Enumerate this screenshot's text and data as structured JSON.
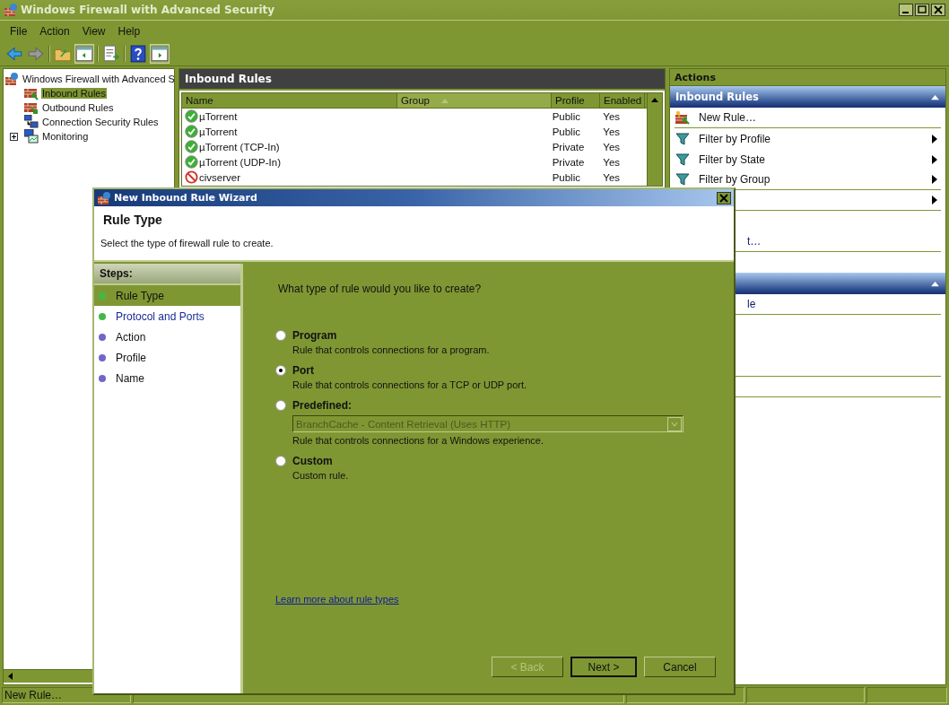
{
  "window": {
    "title": "Windows Firewall with Advanced Security"
  },
  "menu": [
    "File",
    "Action",
    "View",
    "Help"
  ],
  "tree": {
    "root": "Windows Firewall with Advanced S",
    "children": [
      {
        "label": "Inbound Rules",
        "selected": true,
        "kind": "inbound",
        "expandable": false
      },
      {
        "label": "Outbound Rules",
        "selected": false,
        "kind": "outbound",
        "expandable": false
      },
      {
        "label": "Connection Security Rules",
        "selected": false,
        "kind": "connection",
        "expandable": false
      },
      {
        "label": "Monitoring",
        "selected": false,
        "kind": "monitor",
        "expandable": true
      }
    ]
  },
  "center": {
    "title": "Inbound Rules",
    "columns": [
      {
        "label": "Name",
        "sorted": false
      },
      {
        "label": "Group",
        "sorted": true
      },
      {
        "label": "Profile",
        "sorted": false
      },
      {
        "label": "Enabled",
        "sorted": false
      }
    ],
    "rows": [
      {
        "name": "µTorrent",
        "profile": "Public",
        "enabled": "Yes",
        "kind": "allow"
      },
      {
        "name": "µTorrent",
        "profile": "Public",
        "enabled": "Yes",
        "kind": "allow"
      },
      {
        "name": "µTorrent (TCP-In)",
        "profile": "Private",
        "enabled": "Yes",
        "kind": "allow"
      },
      {
        "name": "µTorrent (UDP-In)",
        "profile": "Private",
        "enabled": "Yes",
        "kind": "allow"
      },
      {
        "name": "civserver",
        "profile": "Public",
        "enabled": "Yes",
        "kind": "block"
      }
    ]
  },
  "actions": {
    "title": "Actions",
    "sections": [
      {
        "title": "Inbound Rules",
        "items": [
          {
            "kind": "new",
            "label": "New Rule…",
            "submenu": false,
            "separator": true
          },
          {
            "kind": "filter",
            "label": "Filter by Profile",
            "submenu": true,
            "separator": false
          },
          {
            "kind": "filter",
            "label": "Filter by State",
            "submenu": true,
            "separator": false
          },
          {
            "kind": "filter",
            "label": "Filter by Group",
            "submenu": true,
            "separator": true
          },
          {
            "kind": "covered",
            "submenu": true,
            "separator": true
          },
          {
            "kind": "covered",
            "submenu": false,
            "separator": false
          },
          {
            "kind": "partial",
            "label": "t…",
            "submenu": false,
            "separator": true
          },
          {
            "kind": "covered",
            "submenu": false,
            "separator": false
          }
        ]
      },
      {
        "items": [
          {
            "kind": "partial",
            "label": "le",
            "submenu": false,
            "separator": true
          },
          {
            "kind": "covered",
            "submenu": false,
            "separator": false
          },
          {
            "kind": "covered",
            "submenu": false,
            "separator": false
          },
          {
            "kind": "covered",
            "submenu": false,
            "separator": true
          },
          {
            "kind": "covered",
            "submenu": false,
            "separator": true
          }
        ]
      }
    ]
  },
  "status_bar": [
    "New Rule…"
  ],
  "wizard": {
    "title": "New Inbound Rule Wizard",
    "heading": "Rule Type",
    "subtitle": "Select the type of firewall rule to create.",
    "steps_title": "Steps:",
    "steps": [
      {
        "label": "Rule Type",
        "selected": true,
        "available": true,
        "color": "#44b844"
      },
      {
        "label": "Protocol and Ports",
        "selected": false,
        "available": true,
        "color": "#44b844"
      },
      {
        "label": "Action",
        "selected": false,
        "available": false,
        "color": "#6f66c8"
      },
      {
        "label": "Profile",
        "selected": false,
        "available": false,
        "color": "#6f66c8"
      },
      {
        "label": "Name",
        "selected": false,
        "available": false,
        "color": "#6f66c8"
      }
    ],
    "question": "What type of rule would you like to create?",
    "options": [
      {
        "label": "Program",
        "description": "Rule that controls connections for a program.",
        "selected": false
      },
      {
        "label": "Port",
        "description": "Rule that controls connections for a TCP or UDP port.",
        "selected": true
      },
      {
        "label": "Predefined:",
        "dropdown": {
          "value": "BranchCache - Content Retrieval (Uses HTTP)",
          "disabled": true
        },
        "description": "Rule that controls connections for a Windows experience.",
        "selected": false
      },
      {
        "label": "Custom",
        "description": "Custom rule.",
        "selected": false
      }
    ],
    "link": "Learn more about rule types",
    "buttons": [
      {
        "label": "< Back",
        "disabled": true,
        "default": false
      },
      {
        "label": "Next >",
        "disabled": false,
        "default": true
      },
      {
        "label": "Cancel",
        "disabled": false,
        "default": false
      }
    ]
  }
}
